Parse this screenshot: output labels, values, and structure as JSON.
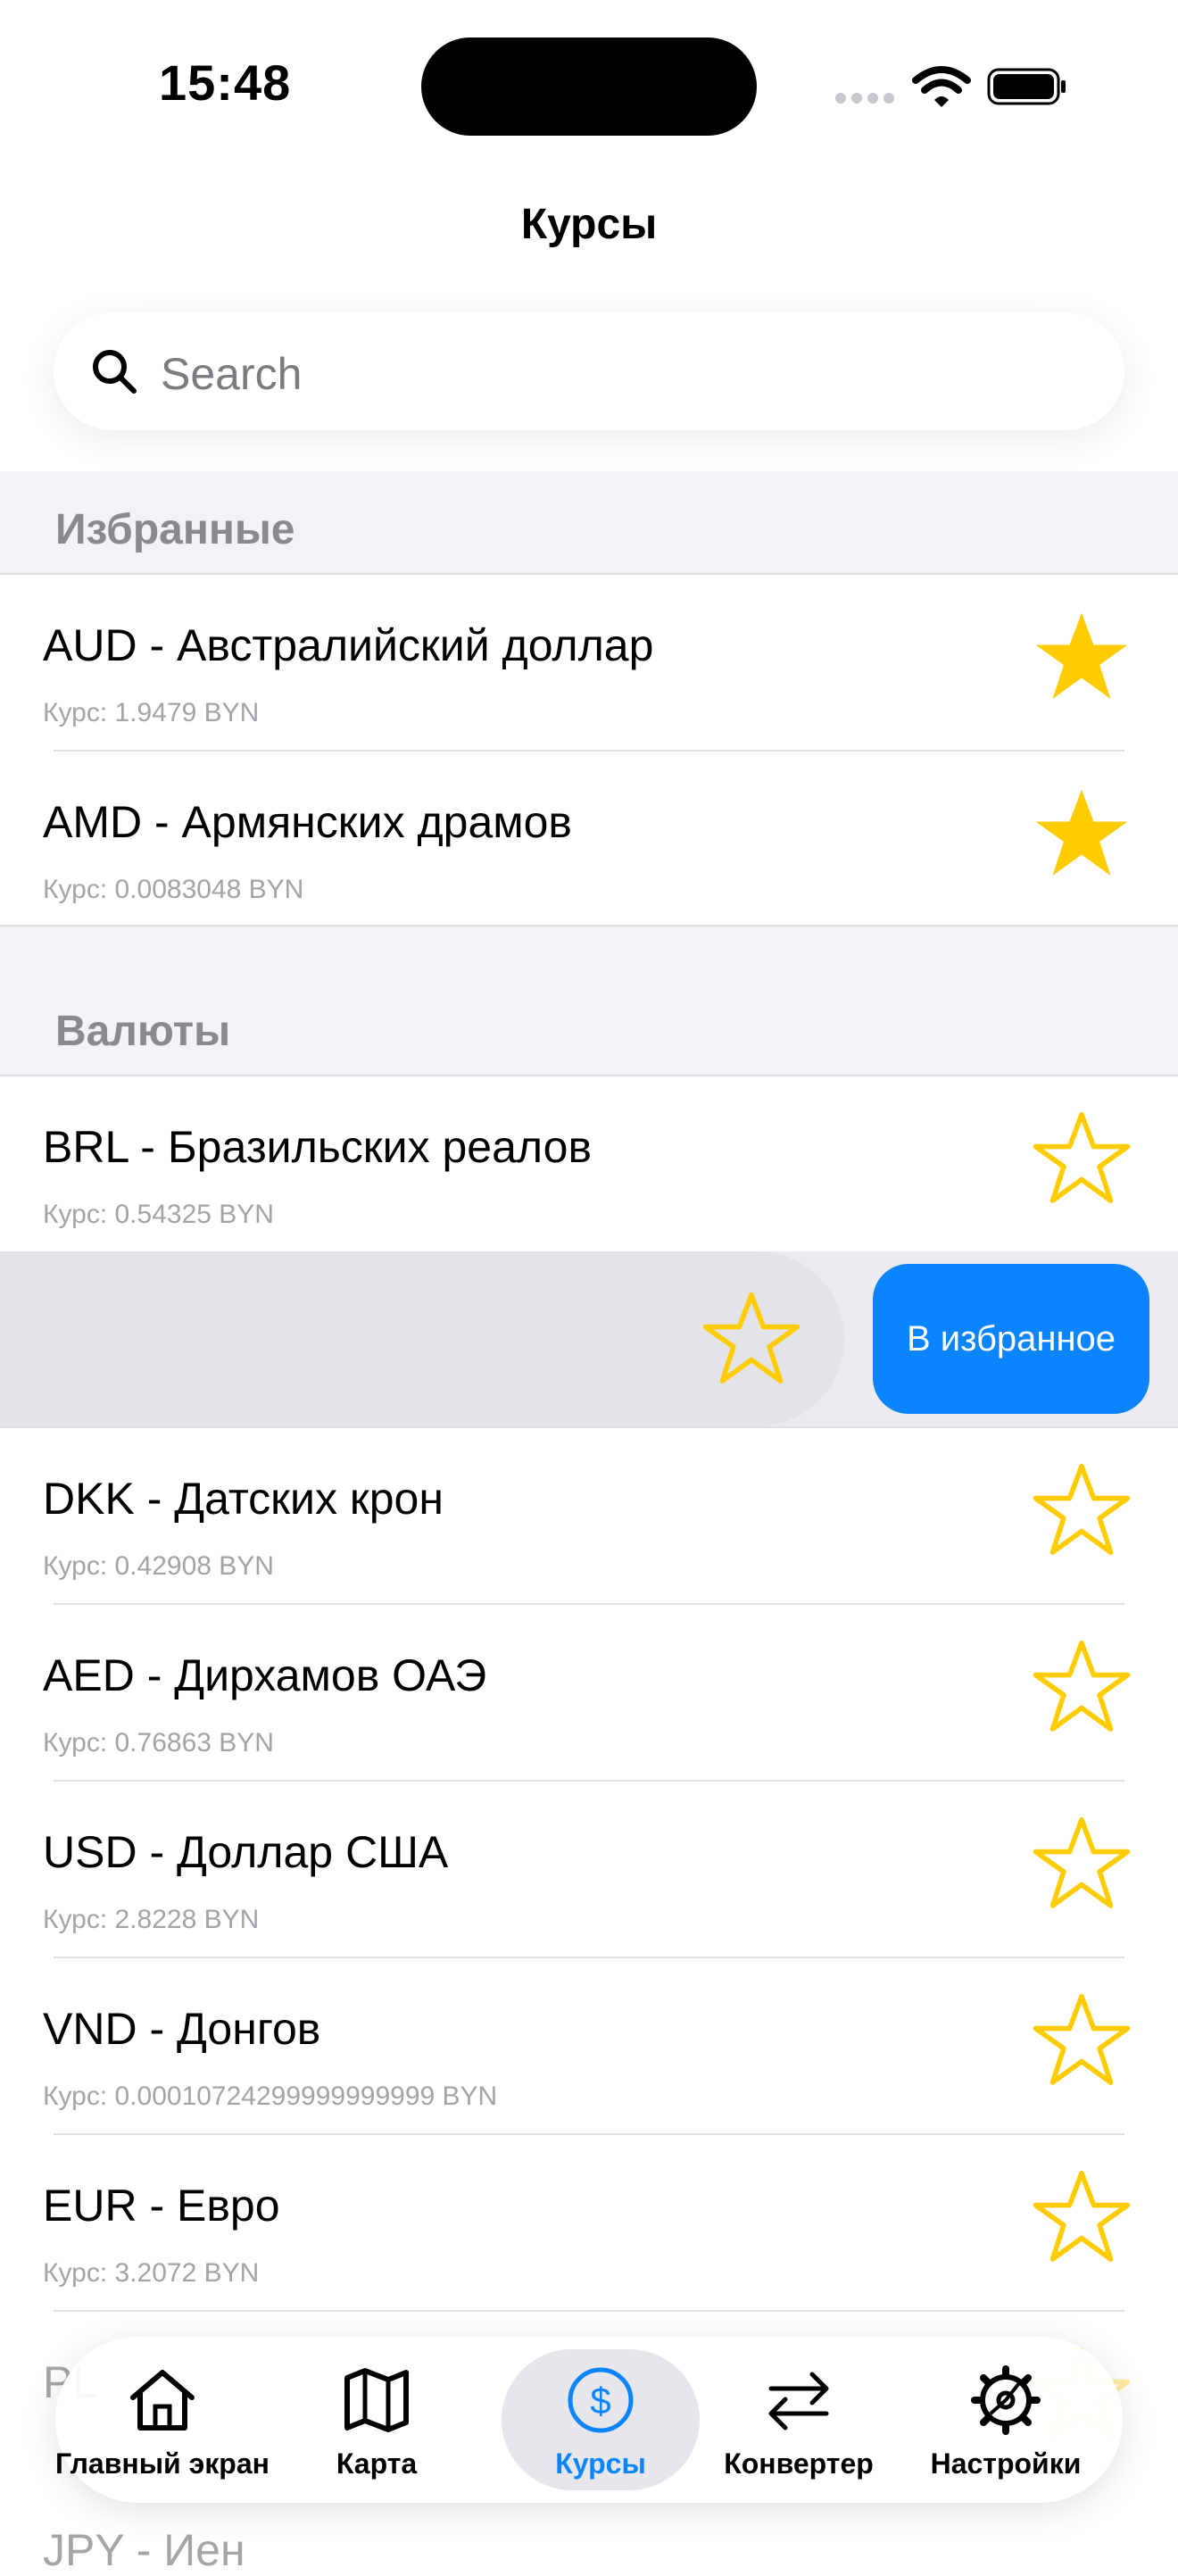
{
  "status_bar": {
    "time": "15:48"
  },
  "nav": {
    "title": "Курсы"
  },
  "search": {
    "placeholder": "Search"
  },
  "sections": {
    "favorites": {
      "header": "Избранные",
      "items": [
        {
          "title": "AUD - Австралийский доллар",
          "rate": "Курс: 1.9479 BYN",
          "favorite": true
        },
        {
          "title": "AMD - Армянских драмов",
          "rate": "Курс: 0.0083048 BYN",
          "favorite": true
        }
      ]
    },
    "currencies": {
      "header": "Валюты",
      "items": [
        {
          "title": "BRL - Бразильских реалов",
          "rate": "Курс: 0.54325 BYN",
          "favorite": false
        },
        {
          "title": "DKK - Датских крон",
          "rate": "Курс: 0.42908 BYN",
          "favorite": false
        },
        {
          "title": "AED - Дирхамов ОАЭ",
          "rate": "Курс: 0.76863 BYN",
          "favorite": false
        },
        {
          "title": "USD - Доллар США",
          "rate": "Курс: 2.8228 BYN",
          "favorite": false
        },
        {
          "title": "VND - Донгов",
          "rate": "Курс: 0.00010724299999999999 BYN",
          "favorite": false
        },
        {
          "title": "EUR - Евро",
          "rate": "Курс: 3.2072 BYN",
          "favorite": false
        }
      ],
      "partial_items": [
        {
          "title": "PL"
        },
        {
          "title": "JPY - Иен"
        }
      ]
    }
  },
  "swipe_action": {
    "label": "В избранное"
  },
  "tabbar": {
    "tabs": [
      {
        "label": "Главный экран",
        "icon": "house-icon"
      },
      {
        "label": "Карта",
        "icon": "map-icon"
      },
      {
        "label": "Курсы",
        "icon": "dollar-circle-icon",
        "active": true
      },
      {
        "label": "Конвертер",
        "icon": "arrows-exchange-icon"
      },
      {
        "label": "Настройки",
        "icon": "gear-icon"
      }
    ]
  },
  "colors": {
    "accent": "#0a84ff",
    "star": "#ffcc00",
    "grouped_bg": "#f2f2f7"
  }
}
